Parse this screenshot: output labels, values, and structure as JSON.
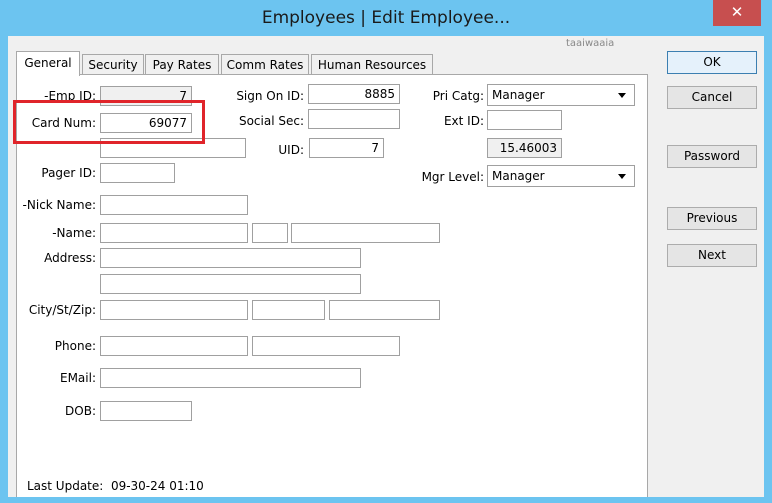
{
  "window": {
    "title": "Employees | Edit Employee...",
    "close_glyph": "✕"
  },
  "tabs": [
    "General",
    "Security",
    "Pay Rates",
    "Comm Rates",
    "Human Resources"
  ],
  "smudge_text": "taaiwaaia",
  "fields": {
    "emp_id": {
      "label": "-Emp ID:",
      "value": "7"
    },
    "card_num": {
      "label": "Card Num:",
      "value": "69077"
    },
    "blank_row3": {
      "value": ""
    },
    "pager_id": {
      "label": "Pager ID:",
      "value": ""
    },
    "nick_name": {
      "label": "-Nick Name:",
      "value": ""
    },
    "name": {
      "label": "-Name:",
      "first": "",
      "mi": "",
      "last": ""
    },
    "address": {
      "label": "Address:",
      "line1": "",
      "line2": ""
    },
    "city_st_zip": {
      "label": "City/St/Zip:",
      "city": "",
      "state": "",
      "zip": ""
    },
    "phone": {
      "label": "Phone:",
      "phone1": "",
      "phone2": ""
    },
    "email": {
      "label": "EMail:",
      "value": ""
    },
    "dob": {
      "label": "DOB:",
      "value": ""
    },
    "sign_on_id": {
      "label": "Sign On ID:",
      "value": "8885"
    },
    "social_sec": {
      "label": "Social Sec:",
      "value": ""
    },
    "uid": {
      "label": "UID:",
      "value": "7"
    },
    "pri_catg": {
      "label": "Pri Catg:",
      "value": "Manager"
    },
    "ext_id": {
      "label": "Ext ID:",
      "value": ""
    },
    "ext_value": {
      "value": "15.46003"
    },
    "mgr_level": {
      "label": "Mgr Level:",
      "value": "Manager"
    }
  },
  "last_update": "Last Update:  09-30-24 01:10",
  "buttons": {
    "ok": "OK",
    "cancel": "Cancel",
    "password": "Password",
    "previous": "Previous",
    "next": "Next"
  },
  "colors": {
    "title_bar": "#6cc4f0",
    "close": "#c74f4f",
    "highlight": "#e0242a"
  }
}
